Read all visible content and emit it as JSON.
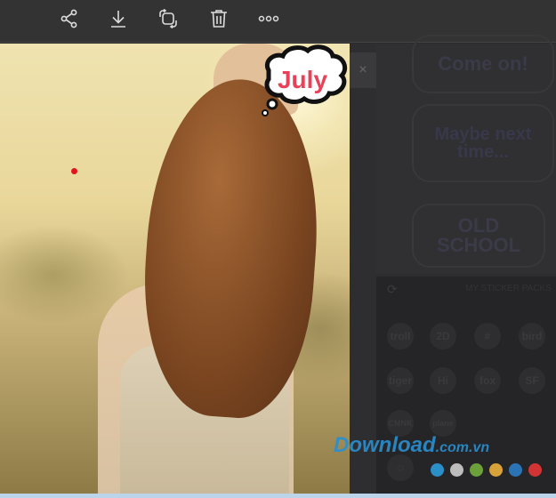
{
  "toolbar": {
    "icons": [
      "share-icon",
      "download-icon",
      "rotate-icon",
      "trash-icon",
      "more-icon"
    ]
  },
  "photo": {
    "sticker_text": "July"
  },
  "panel": {
    "close_label": "×",
    "stickers": [
      "Come on!",
      "Maybe next time...",
      "OLD SCHOOL"
    ],
    "packs_title": "MY STICKER PACKS",
    "pack_icons": [
      "troll",
      "2D",
      "#",
      "bird",
      "tiger",
      "Hi",
      "fox",
      "SF",
      "CMNK",
      "plane"
    ]
  },
  "watermark": {
    "main": "Download",
    ".com.vn": "",
    "suffix": ".com.vn"
  },
  "colors": {
    "swatches": [
      "#2b8fc8",
      "#bdbdbd",
      "#6ca03a",
      "#d7a23a",
      "#2a74b6",
      "#d23434"
    ]
  }
}
